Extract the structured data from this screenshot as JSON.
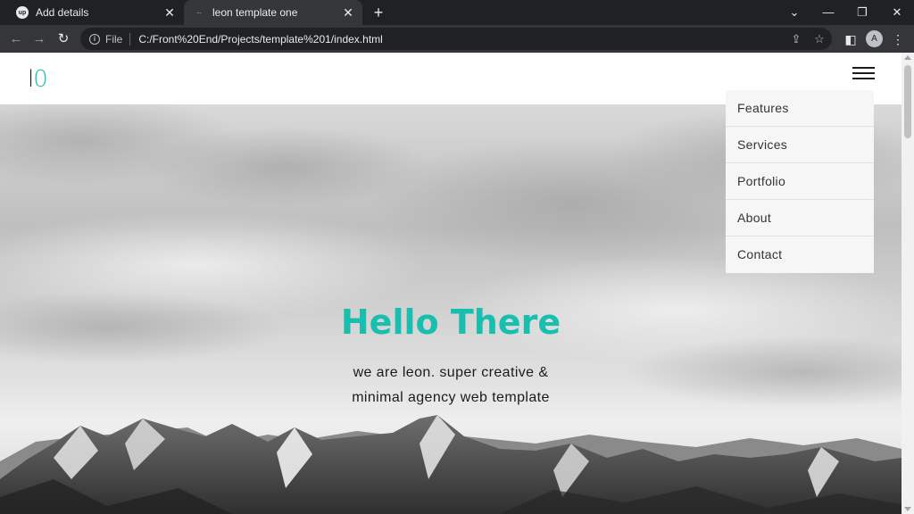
{
  "browser": {
    "tabs": [
      {
        "title": "Add details",
        "favicon": "up"
      },
      {
        "title": "leon template one",
        "favicon": "..."
      }
    ],
    "new_tab_icon": "plus-icon",
    "address": {
      "scheme_label": "File",
      "url": "C:/Front%20End/Projects/template%201/index.html"
    },
    "profile_initial": "A"
  },
  "site": {
    "logo": {
      "letter1": "l",
      "letter2": "0"
    },
    "menu": {
      "items": [
        {
          "label": "Features"
        },
        {
          "label": "Services"
        },
        {
          "label": "Portfolio"
        },
        {
          "label": "About"
        },
        {
          "label": "Contact"
        }
      ]
    },
    "hero": {
      "title": "Hello There",
      "subtitle_line1": "we are leon. super creative &",
      "subtitle_line2": "minimal agency web template"
    }
  },
  "colors": {
    "accent": "#18bfae",
    "chrome_dark": "#202124",
    "chrome_toolbar": "#35363a"
  }
}
